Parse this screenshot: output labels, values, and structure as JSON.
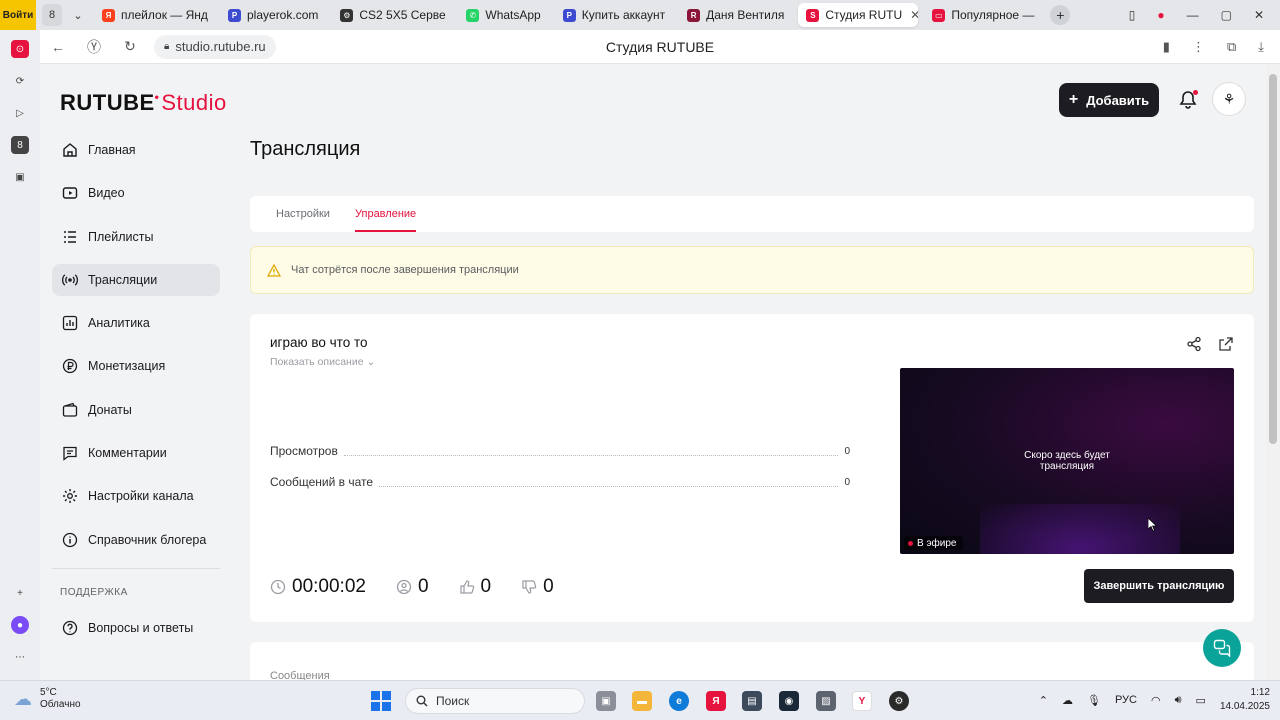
{
  "browser": {
    "menu_label": "Войти",
    "tab_count": "8",
    "tabs": [
      {
        "label": "плейлок — Янд",
        "fav_color": "#fc3f1d",
        "fav_text": "Я",
        "active": false
      },
      {
        "label": "playerok.com",
        "fav_color": "#3c4bd0",
        "fav_text": "P",
        "active": false
      },
      {
        "label": "CS2 5X5 Серве",
        "fav_color": "#333333",
        "fav_text": "⚙",
        "active": false
      },
      {
        "label": "WhatsApp",
        "fav_color": "#25d366",
        "fav_text": "✆",
        "active": false
      },
      {
        "label": "Купить аккаунт",
        "fav_color": "#3c4bd0",
        "fav_text": "P",
        "active": false
      },
      {
        "label": "Даня Вентиля",
        "fav_color": "#8a1538",
        "fav_text": "R",
        "active": false
      },
      {
        "label": "Студия RUTU",
        "fav_color": "#e5133e",
        "fav_text": "S",
        "active": true
      },
      {
        "label": "Популярное —",
        "fav_color": "#e5133e",
        "fav_text": "▭",
        "active": false
      }
    ],
    "url": "studio.rutube.ru",
    "page_title": "Студия RUTUBE"
  },
  "header": {
    "logo_main": "RUTUBE",
    "logo_studio": "Studio",
    "add_label": "Добавить"
  },
  "sidebar": {
    "items": [
      {
        "label": "Главная",
        "icon": "home-icon",
        "active": false
      },
      {
        "label": "Видео",
        "icon": "video-icon",
        "active": false
      },
      {
        "label": "Плейлисты",
        "icon": "playlist-icon",
        "active": false
      },
      {
        "label": "Трансляции",
        "icon": "broadcast-icon",
        "active": true
      },
      {
        "label": "Аналитика",
        "icon": "analytics-icon",
        "active": false
      },
      {
        "label": "Монетизация",
        "icon": "money-icon",
        "active": false
      },
      {
        "label": "Донаты",
        "icon": "wallet-icon",
        "active": false
      },
      {
        "label": "Комментарии",
        "icon": "comment-icon",
        "active": false
      },
      {
        "label": "Настройки канала",
        "icon": "gear-icon",
        "active": false
      },
      {
        "label": "Справочник блогера",
        "icon": "info-icon",
        "active": false
      }
    ],
    "support_heading": "ПОДДЕРЖКА",
    "support_items": [
      {
        "label": "Вопросы и ответы",
        "icon": "question-icon"
      }
    ]
  },
  "main": {
    "title": "Трансляция",
    "tabs": [
      {
        "label": "Настройки",
        "selected": false
      },
      {
        "label": "Управление",
        "selected": true
      }
    ],
    "warning": "Чат сотрётся после завершения трансляции",
    "stream": {
      "title": "играю во что то",
      "show_description": "Показать описание",
      "stats": [
        {
          "label": "Просмотров",
          "value": "0"
        },
        {
          "label": "Сообщений в чате",
          "value": "0"
        }
      ],
      "player_text_line1": "Скоро здесь будет",
      "player_text_line2": "трансляция",
      "live_label": "В эфире",
      "duration": "00:00:02",
      "viewers": "0",
      "likes": "0",
      "dislikes": "0",
      "end_button": "Завершить трансляцию"
    },
    "next_card_label": "Сообщения"
  },
  "taskbar": {
    "temp": "5°C",
    "weather": "Облачно",
    "search_label": "Поиск",
    "lang": "РУС",
    "time": "1:12",
    "date": "14.04.2025"
  },
  "colors": {
    "accent": "#e5133e",
    "dark_button": "#1c1c22",
    "help": "#0aa39a"
  }
}
